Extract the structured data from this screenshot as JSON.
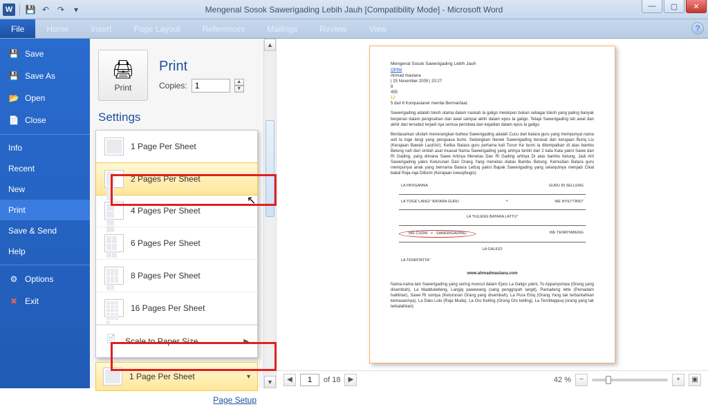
{
  "window": {
    "title": "Mengenal Sosok Sawerigading Lebih Jauh [Compatibility Mode]  -  Microsoft Word",
    "app_letter": "W"
  },
  "ribbon": {
    "file": "File",
    "tabs": [
      "Home",
      "Insert",
      "Page Layout",
      "References",
      "Mailings",
      "Review",
      "View"
    ]
  },
  "file_menu": {
    "save": "Save",
    "save_as": "Save As",
    "open": "Open",
    "close": "Close",
    "info": "Info",
    "recent": "Recent",
    "new": "New",
    "print": "Print",
    "save_send": "Save & Send",
    "help": "Help",
    "options": "Options",
    "exit": "Exit"
  },
  "print_panel": {
    "title": "Print",
    "button": "Print",
    "copies_label": "Copies:",
    "copies_value": "1",
    "settings_title": "Settings",
    "page_setup": "Page Setup"
  },
  "pages_per_sheet": {
    "options": [
      "1 Page Per Sheet",
      "2 Pages Per Sheet",
      "4 Pages Per Sheet",
      "6 Pages Per Sheet",
      "8 Pages Per Sheet",
      "16 Pages Per Sheet"
    ],
    "scale": "Scale to Paper Size",
    "selected": "1 Page Per Sheet"
  },
  "preview_nav": {
    "page": "1",
    "of_label": "of 18",
    "zoom": "42 %"
  },
  "document": {
    "title": "Mengenal Sosok Sawerigading Lebih Jauh",
    "link": "OPINI",
    "author": "Ahmad maulana",
    "date": "| 25 November 2009 | 20:27",
    "nums": [
      "8",
      "455",
      "12"
    ],
    "rating": "5 dari 6 Kompasianer menilai Bermanfaat.",
    "p1": "Sawerigading adalah tokoh utama dalam naskah la galigo meskipun bukan sebagai tokoh yang paling banyak berperan dalam pengisahan dan awal sampai akhir dalam epos la galigo. Tetapi Sawerigading lah awal dan akhir dari tersebut terjadi nya semua peristiwa dan kejadian dalam epos la galigo.",
    "p2": "Berdasarkan silsilah menerangkan bahwa Sawerigading adalah Cucu dari batara guru yang mempunyai nama asli la toge langi yang penguasa bumi. Sedangkan Nenek Sawerigading berasal dari kerajaan Buriq Liu (Kerajaan Bawah Laut/Air). Ketika Batara guru pertama kali Turun Ke bumi ia ditempatkan di atas bambu Betung nah dari sinilah asal muasal Nama Sawerigading yang artinya terdiri dari 2 kata Kata yakni Sawe dan Ri Gading, yang dimana Sawe Artinya Menetas Dan Ri Gading artinya Di atas bambu betung, Jadi Arti Sawerigading yakni Keturunan Dari Orang Yang menetas diatas Bambu Betung. Kemudian Batara guru mempunyai anak yang bernama Batara Lettuq yakni Bapak Sawerigading yang selanjutnya menjadi Cikal bakal Raja-raja Dibumi (Kerajaan luwuq/bugis)",
    "diagram": {
      "n1": "LA PATIGANNA",
      "n2": "GURU RI SELLENG",
      "n3": "LA TOGE\"LANGI\" BATARA GURU",
      "n4": "WE NYILI\"TIMO\"",
      "n5": "LA TIULENG BATARA LATTU\"",
      "n6": "WE CUDAI",
      "n7": "SAWERIGADING",
      "n8": "WE TENRIYABENG",
      "n9": "LA GALIGO",
      "n10": "LA TENRITATTA\""
    },
    "website": "www.ahmadmaulana.com",
    "p3": "Nama-nama lain Sawerigading yang sering muncul dalam Epos La Galigo yakni, To Appanyompa (Orang yang disembah), La Maddukelleng, Langiq pawewang (sang penggoyah langit), Pamadeng lette (Pemadam halilintar), Sawe Ri sompa (Keturunan Orang yang disembah), La Pura Eloq (Orang Yang tak terbantahkan kemauannya), La Datu Lolo (Raja Muda), La Oro Kelling (Orang Oro kelling), La Tenrittappuq (orang yang tak terkalahkan)"
  }
}
